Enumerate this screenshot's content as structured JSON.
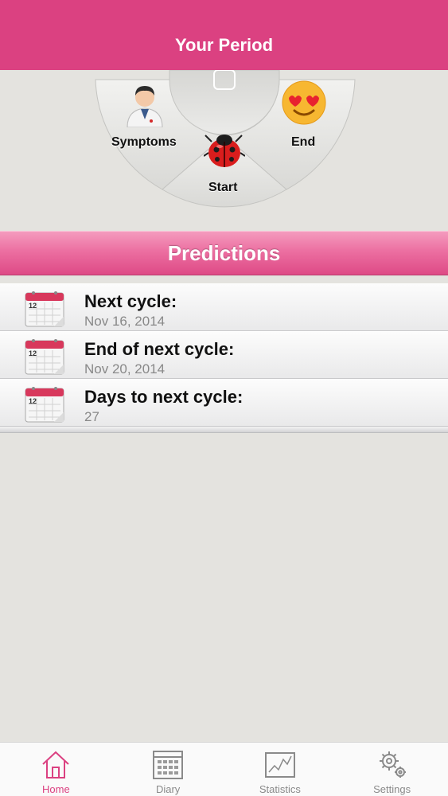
{
  "header": {
    "title": "Your Period"
  },
  "dial": {
    "symptoms_label": "Symptoms",
    "start_label": "Start",
    "end_label": "End",
    "icons": [
      "doctor-icon",
      "ladybug-icon",
      "heart-eyes-emoji-icon"
    ]
  },
  "predictions": {
    "title": "Predictions",
    "items": [
      {
        "title": "Next cycle:",
        "value": "Nov 16, 2014",
        "icon": "calendar-icon",
        "icon_day": "12"
      },
      {
        "title": "End of next cycle:",
        "value": "Nov 20, 2014",
        "icon": "calendar-icon",
        "icon_day": "12"
      },
      {
        "title": "Days to next cycle:",
        "value": "27",
        "icon": "calendar-icon",
        "icon_day": "12"
      }
    ]
  },
  "tabbar": {
    "tabs": [
      {
        "label": "Home",
        "icon": "home-icon",
        "active": true
      },
      {
        "label": "Diary",
        "icon": "calendar-grid-icon",
        "active": false
      },
      {
        "label": "Statistics",
        "icon": "chart-icon",
        "active": false
      },
      {
        "label": "Settings",
        "icon": "gear-icon",
        "active": false
      }
    ]
  },
  "colors": {
    "accent": "#db4181",
    "background": "#e4e3df"
  }
}
